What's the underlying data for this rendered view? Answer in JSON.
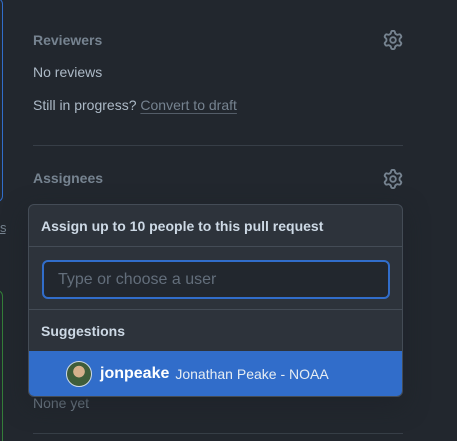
{
  "reviewers": {
    "title": "Reviewers",
    "status": "No reviews",
    "in_progress_prompt": "Still in progress?",
    "convert_link": "Convert to draft"
  },
  "assignees": {
    "title": "Assignees",
    "menu_header": "Assign up to 10 people to this pull request",
    "filter_placeholder": "Type or choose a user",
    "suggestions_label": "Suggestions",
    "suggestion": {
      "login": "jonpeake",
      "name": "Jonathan Peake - NOAA"
    }
  },
  "labels": {
    "status": "None yet"
  },
  "left_fragment": "s",
  "colors": {
    "accent": "#316dca",
    "background": "#22272e",
    "overlay": "#2d333b"
  },
  "icons": {
    "settings": "gear-icon"
  }
}
